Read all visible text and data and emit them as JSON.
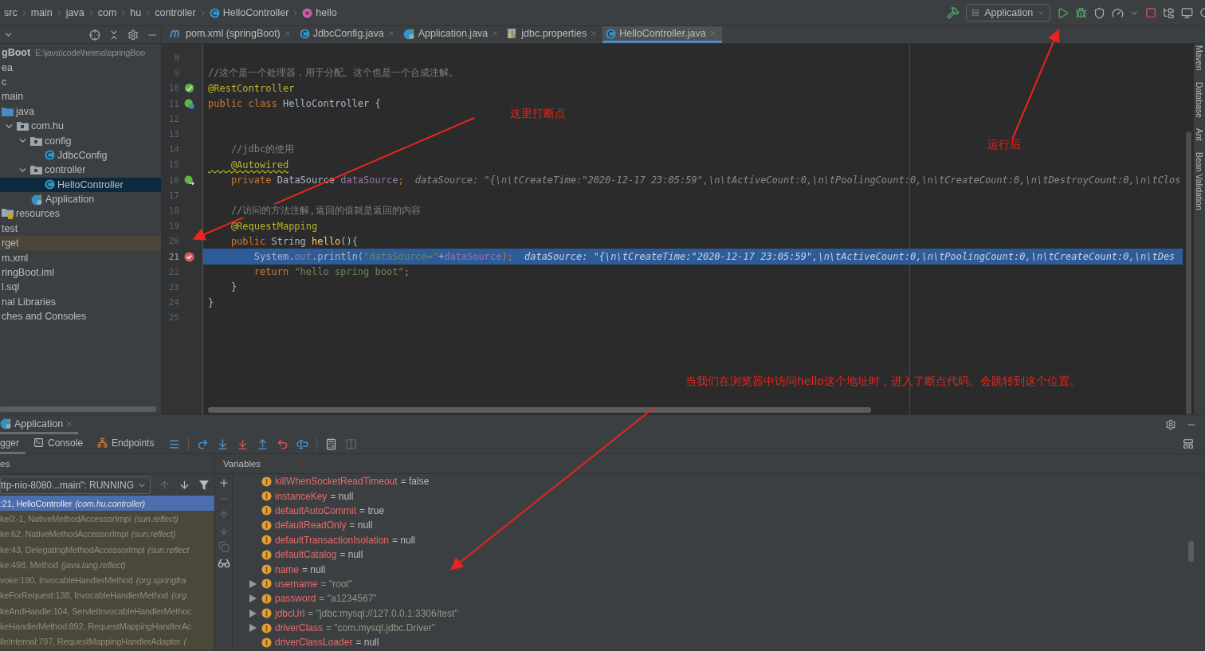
{
  "breadcrumbs": [
    {
      "label": "src",
      "kind": "folder"
    },
    {
      "label": "main",
      "kind": "folder"
    },
    {
      "label": "java",
      "kind": "folder"
    },
    {
      "label": "com",
      "kind": "folder"
    },
    {
      "label": "hu",
      "kind": "folder"
    },
    {
      "label": "controller",
      "kind": "folder"
    },
    {
      "label": "HelloController",
      "kind": "class"
    },
    {
      "label": "hello",
      "kind": "method"
    }
  ],
  "run_config": {
    "label": "Application"
  },
  "tabs": [
    {
      "label": "pom.xml (springBoot)",
      "kind": "maven",
      "selected": false
    },
    {
      "label": "JdbcConfig.java",
      "kind": "class",
      "selected": false
    },
    {
      "label": "Application.java",
      "kind": "app",
      "selected": false
    },
    {
      "label": "jdbc.properties",
      "kind": "properties",
      "selected": false
    },
    {
      "label": "HelloController.java",
      "kind": "class",
      "selected": true
    }
  ],
  "project_tree": [
    {
      "label": "gBoot",
      "path": "E:\\java\\code\\heima\\springBoo",
      "selected": false,
      "children": [
        {
          "label": "ea",
          "selected": false
        },
        {
          "label": "c",
          "selected": false,
          "children": [
            {
              "label": "main",
              "selected": false,
              "children": [
                {
                  "label": "java",
                  "kind": "source-folder",
                  "selected": false,
                  "children": [
                    {
                      "label": "com.hu",
                      "kind": "package",
                      "expanded": true,
                      "selected": false,
                      "children": [
                        {
                          "label": "config",
                          "kind": "package",
                          "expanded": true,
                          "selected": false,
                          "children": [
                            {
                              "label": "JdbcConfig",
                              "kind": "class",
                              "selected": false
                            }
                          ]
                        },
                        {
                          "label": "controller",
                          "kind": "package",
                          "expanded": true,
                          "selected": false,
                          "children": [
                            {
                              "label": "HelloController",
                              "kind": "class",
                              "selected": true
                            }
                          ]
                        },
                        {
                          "label": "Application",
                          "kind": "app",
                          "selected": false
                        }
                      ]
                    }
                  ]
                },
                {
                  "label": "resources",
                  "kind": "resources",
                  "selected": false
                }
              ]
            },
            {
              "label": "test",
              "selected": false
            }
          ]
        },
        {
          "label": "rget",
          "excluded": true,
          "selected": false
        },
        {
          "label": "m.xml",
          "selected": false
        },
        {
          "label": "ringBoot.iml",
          "selected": false
        },
        {
          "label": "l.sql",
          "selected": false
        }
      ]
    },
    {
      "label": "nal Libraries",
      "selected": false
    },
    {
      "label": "ches and Consoles",
      "selected": false
    }
  ],
  "editor": {
    "lines": [
      {
        "number": "8"
      },
      {
        "number": "9",
        "segments": [
          {
            "kind": "comment",
            "text": "//这个是一个处理器，用于分配。这个也是一个合成注解。"
          }
        ]
      },
      {
        "number": "10",
        "kind": "bean",
        "segments": [
          {
            "kind": "annotation",
            "text": "@RestController"
          }
        ]
      },
      {
        "number": "11",
        "kind": "bean-class",
        "segments": [
          {
            "kind": "keyword",
            "text": "public class "
          },
          {
            "kind": "plain",
            "text": "HelloController {"
          }
        ]
      },
      {
        "number": "12"
      },
      {
        "number": "13"
      },
      {
        "number": "14",
        "segments": [
          {
            "kind": "comment",
            "text": "    //jdbc的使用"
          }
        ]
      },
      {
        "number": "15",
        "segments": [
          {
            "kind": "annotation-warn",
            "text": "    @Autowired"
          }
        ]
      },
      {
        "number": "16",
        "kind": "bean-injected",
        "segments": [
          {
            "kind": "keyword",
            "text": "    private "
          },
          {
            "kind": "plain",
            "text": "DataSource "
          },
          {
            "kind": "field",
            "text": "dataSource"
          },
          {
            "kind": "keyword",
            "text": ";"
          },
          {
            "kind": "hint",
            "text": "dataSource: \"{\\n\\tCreateTime:\"2020-12-17 23:05:59\",\\n\\tActiveCount:0,\\n\\tPoolingCount:0,\\n\\tCreateCount:0,\\n\\tDestroyCount:0,\\n\\tClos"
          }
        ]
      },
      {
        "number": "17"
      },
      {
        "number": "18",
        "segments": [
          {
            "kind": "comment",
            "text": "    //访问的方法注解,返回的值就是返回的内容"
          }
        ]
      },
      {
        "number": "19",
        "segments": [
          {
            "kind": "annotation",
            "text": "    @RequestMapping"
          }
        ]
      },
      {
        "number": "20",
        "segments": [
          {
            "kind": "keyword",
            "text": "    public "
          },
          {
            "kind": "plain",
            "text": "String "
          },
          {
            "kind": "method",
            "text": "hello"
          },
          {
            "kind": "plain",
            "text": "(){"
          }
        ]
      },
      {
        "number": "21",
        "breakpoint": true,
        "current": true,
        "segments": [
          {
            "kind": "plain",
            "text": "        System."
          },
          {
            "kind": "static",
            "text": "out"
          },
          {
            "kind": "plain",
            "text": ".println("
          },
          {
            "kind": "string",
            "text": "\"dataSource=\""
          },
          {
            "kind": "plain",
            "text": "+"
          },
          {
            "kind": "field",
            "text": "dataSource"
          },
          {
            "kind": "keyword",
            "text": ");"
          },
          {
            "kind": "hint",
            "text": "dataSource: \"{\\n\\tCreateTime:\"2020-12-17 23:05:59\",\\n\\tActiveCount:0,\\n\\tPoolingCount:0,\\n\\tCreateCount:0,\\n\\tDes"
          }
        ]
      },
      {
        "number": "22",
        "segments": [
          {
            "kind": "keyword",
            "text": "        return "
          },
          {
            "kind": "string",
            "text": "\"hello spring boot\""
          },
          {
            "kind": "keyword",
            "text": ";"
          }
        ]
      },
      {
        "number": "23",
        "segments": [
          {
            "kind": "plain",
            "text": "    }"
          }
        ]
      },
      {
        "number": "24",
        "segments": [
          {
            "kind": "plain",
            "text": "}"
          }
        ]
      },
      {
        "number": "25"
      }
    ]
  },
  "side_tools": [
    {
      "label": "Maven"
    },
    {
      "label": "Database"
    },
    {
      "label": "Ant"
    },
    {
      "label": "Bean Validation"
    }
  ],
  "debug": {
    "session_tab": {
      "label": "Application"
    },
    "tabs": [
      {
        "label": "gger",
        "kind": "plain",
        "selected": true
      },
      {
        "label": "Console",
        "kind": "console",
        "selected": false
      },
      {
        "label": "Endpoints",
        "kind": "endpoints",
        "selected": false
      }
    ],
    "frames_title": "es",
    "variables_title": "Variables",
    "thread": "ttp-nio-8080...main\": RUNNING",
    "frames": [
      {
        "method": ":21, HelloController",
        "location": "(com.hu.controller)",
        "library": false,
        "selected": true
      },
      {
        "method": "ke0:-1, NativeMethodAccessorImpl",
        "location": "(sun.reflect)",
        "library": true,
        "selected": false
      },
      {
        "method": "ke:62, NativeMethodAccessorImpl",
        "location": "(sun.reflect)",
        "library": true,
        "selected": false
      },
      {
        "method": "ke:43, DelegatingMethodAccessorImpl",
        "location": "(sun.reflect",
        "library": true,
        "selected": false
      },
      {
        "method": "ke:498, Method",
        "location": "(java.lang.reflect)",
        "library": true,
        "selected": false
      },
      {
        "method": "voke:190, InvocableHandlerMethod",
        "location": "(org.springfra",
        "library": true,
        "selected": false
      },
      {
        "method": "keForRequest:138, InvocableHandlerMethod",
        "location": "(org.",
        "library": true,
        "selected": false
      },
      {
        "method": "keAndHandle:104, ServletInvocableHandlerMethoc",
        "library": true,
        "selected": false
      },
      {
        "method": "keHandlerMethod:892, RequestMappingHandlerAc",
        "library": true,
        "selected": false
      },
      {
        "method": "lleInternal:797, RequestMappingHandlerAdapter",
        "location": "(",
        "library": true,
        "selected": false
      }
    ],
    "variables": [
      {
        "name": "killWhenSocketReadTimeout",
        "value": "= false",
        "kind": "plain"
      },
      {
        "name": "instanceKey",
        "value": "= null",
        "kind": "plain"
      },
      {
        "name": "defaultAutoCommit",
        "value": "= true",
        "kind": "plain"
      },
      {
        "name": "defaultReadOnly",
        "value": "= null",
        "kind": "plain"
      },
      {
        "name": "defaultTransactionIsolation",
        "value": "= null",
        "kind": "plain"
      },
      {
        "name": "defaultCatalog",
        "value": "= null",
        "kind": "plain"
      },
      {
        "name": "name",
        "value": "= null",
        "kind": "plain"
      },
      {
        "name": "username",
        "value": "= \"root\"",
        "kind": "string",
        "expanded": false
      },
      {
        "name": "password",
        "value": "= \"a1234567\"",
        "kind": "string",
        "expanded": false
      },
      {
        "name": "jdbcUrl",
        "value": "= \"jdbc:mysql://127.0.0.1:3306/test\"",
        "kind": "string",
        "expanded": false
      },
      {
        "name": "driverClass",
        "value": "= \"com.mysql.jdbc.Driver\"",
        "kind": "string",
        "expanded": false
      },
      {
        "name": "driverClassLoader",
        "value": "= null",
        "kind": "plain"
      }
    ]
  },
  "annotations": [
    {
      "text": "这里打断点"
    },
    {
      "text": "运行后"
    },
    {
      "text": "当我们在浏览器中访问hello这个地址时，进入了断点代码。会跳转到这个位置。"
    }
  ]
}
